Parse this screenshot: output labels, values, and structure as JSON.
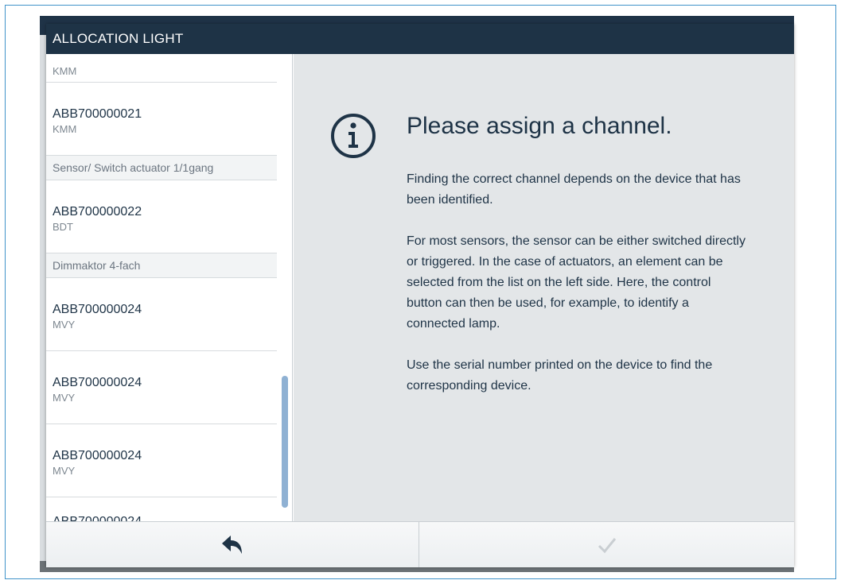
{
  "dialog": {
    "title": "ALLOCATION LIGHT"
  },
  "list": {
    "top_partial": {
      "type": "KMM"
    },
    "items": [
      {
        "serial": "ABB700000021",
        "type": "KMM"
      },
      {
        "group": "Sensor/ Switch actuator 1/1gang"
      },
      {
        "serial": "ABB700000022",
        "type": "BDT"
      },
      {
        "group": "Dimmaktor 4-fach"
      },
      {
        "serial": "ABB700000024",
        "type": "MVY"
      },
      {
        "serial": "ABB700000024",
        "type": "MVY"
      },
      {
        "serial": "ABB700000024",
        "type": "MVY"
      }
    ],
    "bottom_partial": {
      "serial": "ABB700000024"
    }
  },
  "info": {
    "icon": "info-icon",
    "heading": "Please assign a channel.",
    "paragraph1": "Finding the correct channel depends on the device that has been identified.",
    "paragraph2": "For most sensors, the sensor can be either switched directly or triggered. In the case of actuators, an element can be selected from the list on the left side. Here, the control button can then be used, for example, to identify a connected lamp.",
    "paragraph3": "Use the serial number printed on the device to find the corresponding device."
  },
  "buttons": {
    "back_icon": "back-arrow-icon",
    "confirm_icon": "checkmark-icon"
  },
  "colors": {
    "header_bg": "#1e3346",
    "accent_blue": "#8fb1d3",
    "panel_bg": "#e3e6e8",
    "text_dark": "#1e3346"
  }
}
